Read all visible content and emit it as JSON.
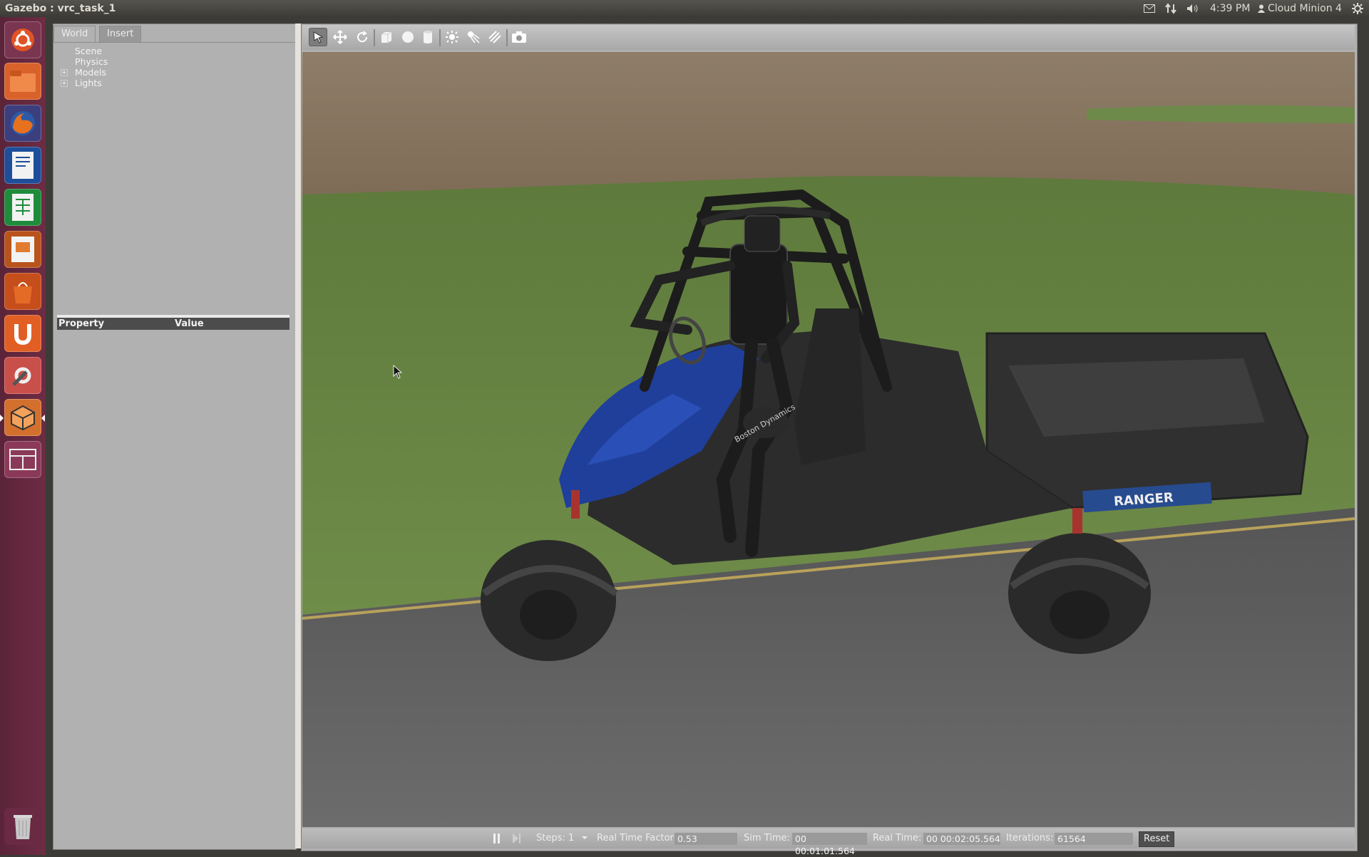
{
  "window": {
    "title": "Gazebo : vrc_task_1"
  },
  "top_panel": {
    "time": "4:39 PM",
    "user": "Cloud Minion 4",
    "indicators": [
      "mail-icon",
      "network-icon",
      "volume-icon",
      "session-icon"
    ]
  },
  "launcher": {
    "items": [
      "dash-home-icon",
      "files-icon",
      "firefox-icon",
      "writer-icon",
      "calc-icon",
      "impress-icon",
      "software-center-icon",
      "ubuntu-one-icon",
      "settings-icon",
      "gazebo-icon",
      "workspace-switcher-icon",
      "trash-icon"
    ]
  },
  "left_panel": {
    "tabs": [
      {
        "label": "World",
        "active": true
      },
      {
        "label": "Insert",
        "active": false
      }
    ],
    "tree": [
      {
        "label": "Scene",
        "expandable": false
      },
      {
        "label": "Physics",
        "expandable": false
      },
      {
        "label": "Models",
        "expandable": true,
        "expander": "+"
      },
      {
        "label": "Lights",
        "expandable": true,
        "expander": "+"
      }
    ],
    "properties": {
      "col_property": "Property",
      "col_value": "Value"
    }
  },
  "toolbar": {
    "tools": [
      "select-arrow-icon",
      "translate-icon",
      "rotate-icon",
      "box-icon",
      "sphere-icon",
      "cylinder-icon",
      "point-light-icon",
      "spot-light-icon",
      "directional-light-icon",
      "screenshot-icon"
    ],
    "selected": "select-arrow-icon"
  },
  "status_bar": {
    "steps_label": "Steps:",
    "steps_value": "1",
    "rtf_label": "Real Time Factor:",
    "rtf_value": "0.53",
    "sim_time_label": "Sim Time:",
    "sim_time_value": "00 00:01:01.564",
    "real_time_label": "Real Time:",
    "real_time_value": "00 00:02:05.564",
    "iterations_label": "Iterations:",
    "iterations_value": "61564",
    "reset_label": "Reset"
  },
  "scene": {
    "vehicle_logo": "RANGER",
    "robot_logo": "Boston Dynamics",
    "colors": {
      "grass": "#5f7a3a",
      "dirt": "#8f7a62",
      "road": "#5e5e5e",
      "vehicle_body": "#1f3f9a",
      "frame": "#232323"
    }
  }
}
